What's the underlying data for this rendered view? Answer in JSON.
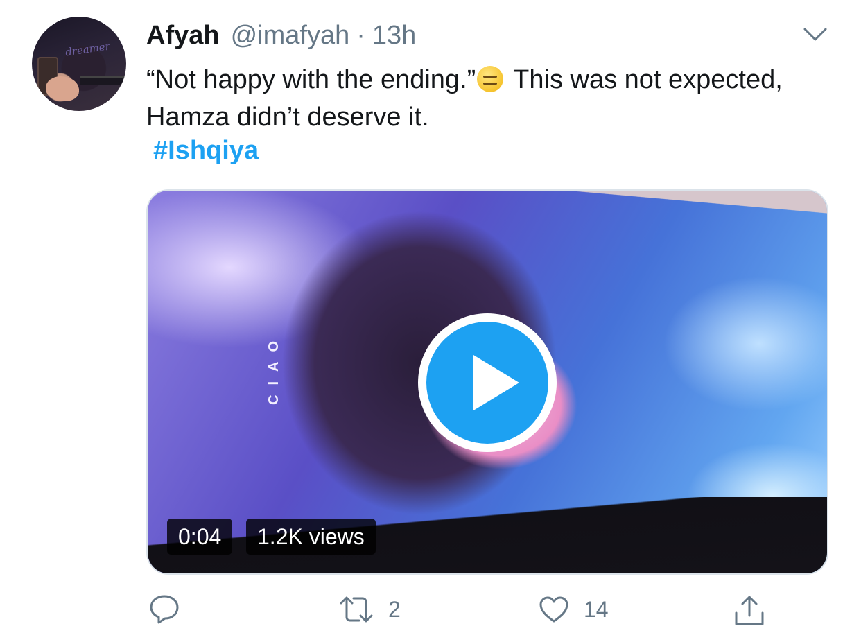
{
  "tweet": {
    "author_name": "Afyah",
    "handle": "@imafyah",
    "separator": "·",
    "time": "13h",
    "avatar_text": "dreamer",
    "text_part1": "“Not happy with the ending.”",
    "text_part2": " This was not expected, Hamza didn’t deserve it.",
    "emoji": "expressionless-face-emoji",
    "hashtag": "#Ishqiya"
  },
  "video": {
    "overlay_text": "CIAO",
    "duration": "0:04",
    "views": "1.2K views"
  },
  "actions": {
    "reply_count": "",
    "retweet_count": "2",
    "like_count": "14"
  },
  "colors": {
    "accent": "#1da1f2",
    "text": "#14171a",
    "secondary": "#657786"
  },
  "icons": [
    "reply-icon",
    "retweet-icon",
    "like-icon",
    "share-icon",
    "chevron-down-icon",
    "play-icon"
  ]
}
